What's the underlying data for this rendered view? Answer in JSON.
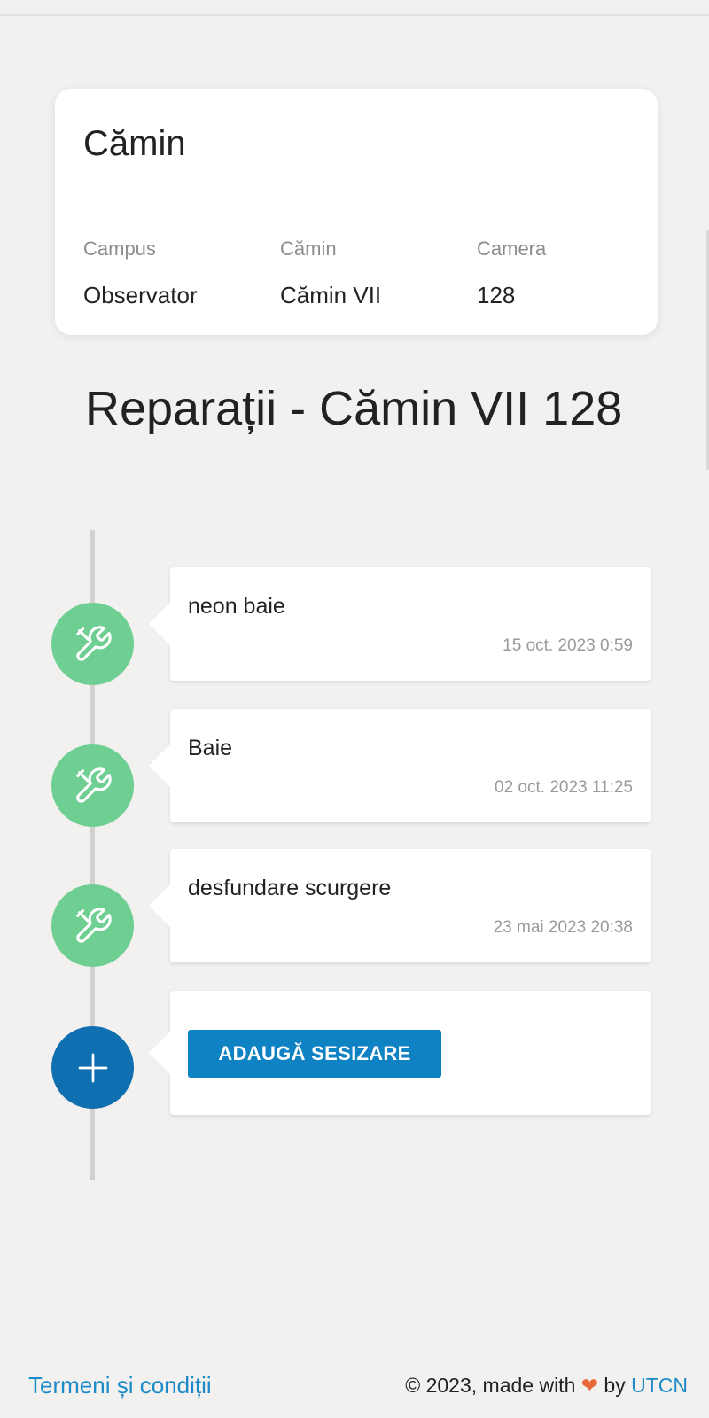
{
  "info_card": {
    "title": "Cămin",
    "columns": [
      {
        "label": "Campus",
        "value": "Observator"
      },
      {
        "label": "Cămin",
        "value": "Cămin VII"
      },
      {
        "label": "Camera",
        "value": "128"
      }
    ]
  },
  "page_title": "Reparații - Cămin VII 128",
  "timeline": {
    "items": [
      {
        "description": "neon baie",
        "date": "15 oct. 2023 0:59",
        "icon": "tools-icon"
      },
      {
        "description": "Baie",
        "date": "02 oct. 2023 11:25",
        "icon": "tools-icon"
      },
      {
        "description": "desfundare scurgere",
        "date": "23 mai 2023 20:38",
        "icon": "tools-icon"
      }
    ],
    "add_button_label": "ADAUGĂ SESIZARE",
    "add_icon": "plus-icon"
  },
  "footer": {
    "terms_link": "Termeni și condiții",
    "copyright_prefix": "© 2023, made with",
    "copyright_by": "by",
    "brand": "UTCN"
  },
  "colors": {
    "background": "#f2f1ef",
    "repair_icon_bg": "#6fcf93",
    "add_icon_bg": "#0f6fb0",
    "button": "#0f82c4",
    "link": "#1a8bc8",
    "heart": "#e86a3a"
  }
}
